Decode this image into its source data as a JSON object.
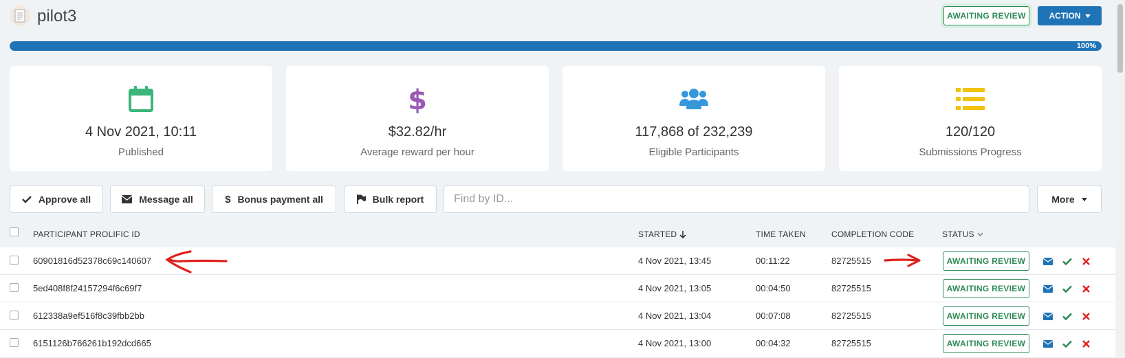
{
  "header": {
    "study_name": "pilot3",
    "status": "AWAITING REVIEW",
    "action_label": "ACTION"
  },
  "progress": {
    "percent": 100,
    "label": "100%"
  },
  "stats": [
    {
      "value": "4 Nov 2021, 10:11",
      "label": "Published",
      "icon": "calendar-icon",
      "color": "#3bb57a"
    },
    {
      "value": "$32.82/hr",
      "label": "Average reward per hour",
      "icon": "dollar-icon",
      "color": "#9b59b6"
    },
    {
      "value": "117,868 of 232,239",
      "label": "Eligible Participants",
      "icon": "users-icon",
      "color": "#3498db"
    },
    {
      "value": "120/120",
      "label": "Submissions Progress",
      "icon": "list-icon",
      "color": "#f1c40f"
    }
  ],
  "toolbar": {
    "approve_all": "Approve all",
    "message_all": "Message all",
    "bonus_all": "Bonus payment all",
    "bulk_report": "Bulk report",
    "search_placeholder": "Find by ID...",
    "more": "More"
  },
  "table": {
    "columns": {
      "id": "PARTICIPANT PROLIFIC ID",
      "started": "STARTED",
      "time_taken": "TIME TAKEN",
      "completion_code": "COMPLETION CODE",
      "status": "STATUS"
    },
    "rows": [
      {
        "id": "60901816d52378c69c140607",
        "started": "4 Nov 2021, 13:45",
        "time_taken": "00:11:22",
        "completion_code": "82725515",
        "status": "AWAITING REVIEW"
      },
      {
        "id": "5ed408f8f24157294f6c69f7",
        "started": "4 Nov 2021, 13:05",
        "time_taken": "00:04:50",
        "completion_code": "82725515",
        "status": "AWAITING REVIEW"
      },
      {
        "id": "612338a9ef516f8c39fbb2bb",
        "started": "4 Nov 2021, 13:04",
        "time_taken": "00:07:08",
        "completion_code": "82725515",
        "status": "AWAITING REVIEW"
      },
      {
        "id": "6151126b766261b192dcd665",
        "started": "4 Nov 2021, 13:00",
        "time_taken": "00:04:32",
        "completion_code": "82725515",
        "status": "AWAITING REVIEW"
      }
    ]
  },
  "colors": {
    "brand_blue": "#1f73b7",
    "status_green": "#2e8b57",
    "annotation_red": "#e02020"
  }
}
